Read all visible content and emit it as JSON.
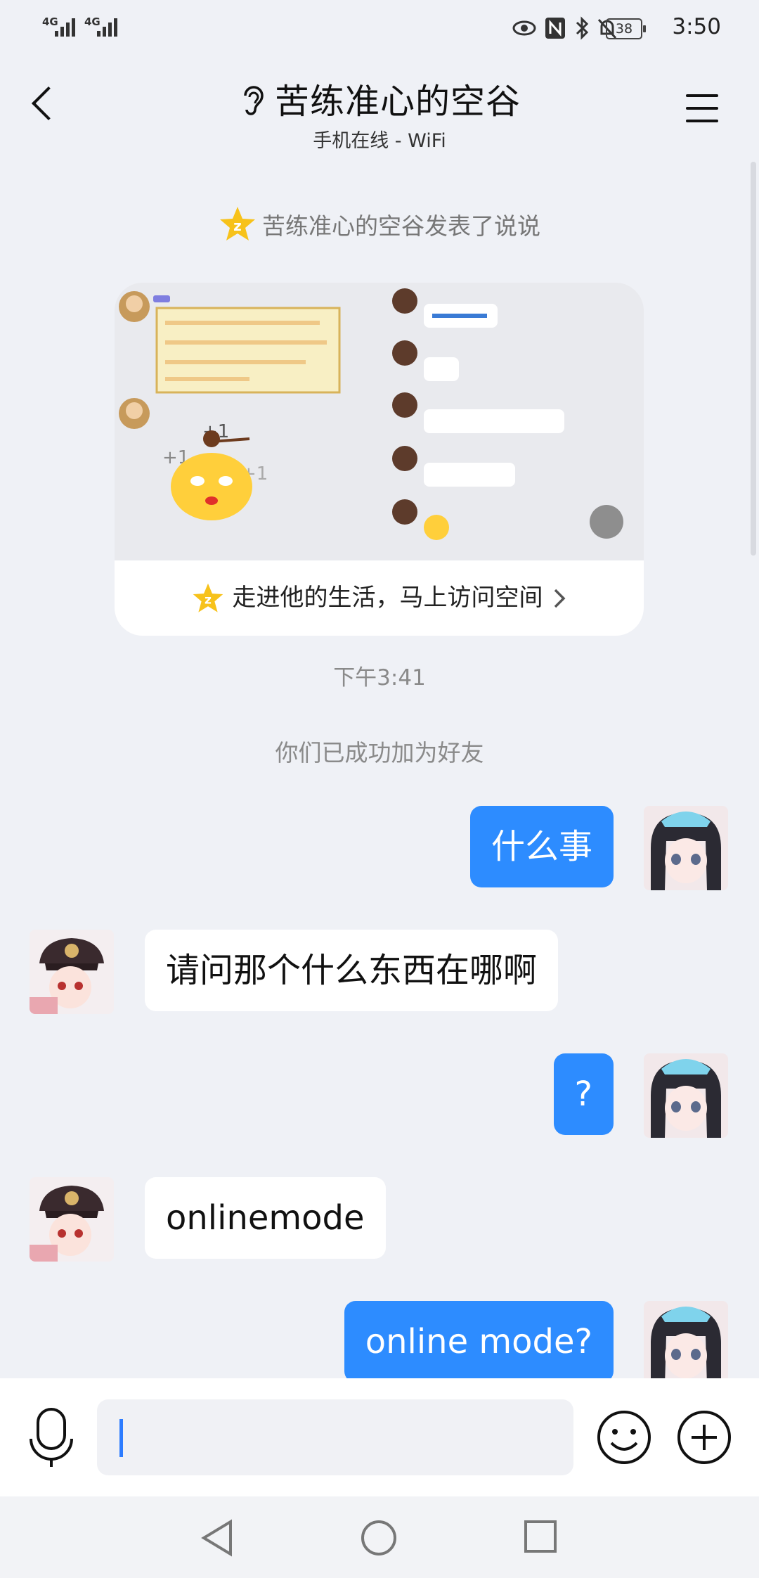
{
  "status_bar": {
    "signal_1": "4G",
    "signal_2": "4G",
    "battery": "38",
    "time": "3:50"
  },
  "header": {
    "title": "苦练准心的空谷",
    "subtitle": "手机在线 - WiFi"
  },
  "notice": "苦练准心的空谷发表了说说",
  "post_card": {
    "footer_text": "走进他的生活，马上访问空间"
  },
  "timestamp": "下午3:41",
  "friend_notice": "你们已成功加为好友",
  "messages": [
    {
      "side": "me",
      "text": "什么事"
    },
    {
      "side": "other",
      "text": "请问那个什么东西在哪啊"
    },
    {
      "side": "me",
      "text": "?"
    },
    {
      "side": "other",
      "text": "onlinemode"
    },
    {
      "side": "me",
      "text": "online mode?"
    }
  ],
  "colors": {
    "accent": "#2d8cff",
    "background": "#eff1f6",
    "qzone_star": "#f7c21a"
  }
}
